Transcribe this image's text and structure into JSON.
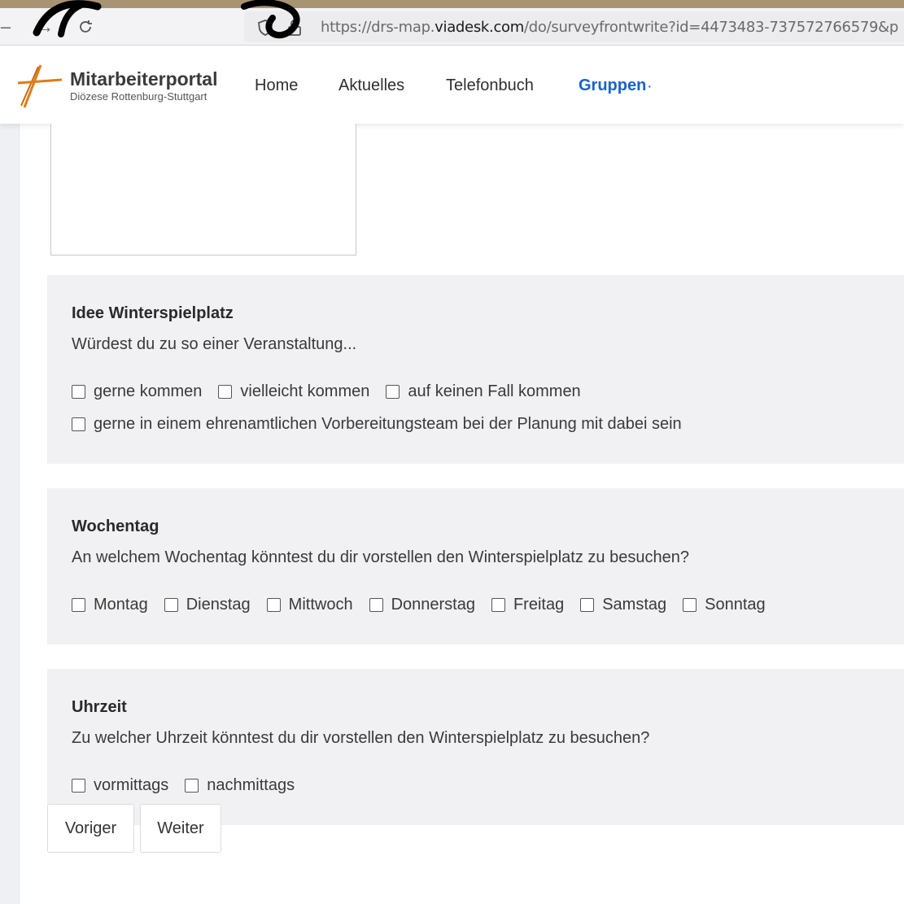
{
  "browser": {
    "url_prefix": "https://drs-map.",
    "url_domain": "viadesk.com",
    "url_path": "/do/surveyfrontwrite?id=4473483-737572766579&p"
  },
  "header": {
    "logo_title": "Mitarbeiterportal",
    "logo_subtitle": "Diözese Rottenburg-Stuttgart",
    "nav": [
      "Home",
      "Aktuelles",
      "Telefonbuch",
      "Gruppen"
    ],
    "nav_active": "Gruppen",
    "nav_active_suffix": "·"
  },
  "sections": [
    {
      "title": "Idee Winterspielplatz",
      "question": "Würdest du zu so einer Veranstaltung...",
      "rows": [
        [
          {
            "label": "gerne kommen",
            "checked": false
          },
          {
            "label": "vielleicht kommen",
            "checked": false
          },
          {
            "label": "auf keinen Fall kommen",
            "checked": false
          }
        ],
        [
          {
            "label": "gerne in einem ehrenamtlichen Vorbereitungsteam bei der Planung mit dabei sein",
            "checked": false
          }
        ]
      ]
    },
    {
      "title": "Wochentag",
      "question": "An welchem Wochentag könntest du dir vorstellen den Winterspielplatz zu besuchen?",
      "rows": [
        [
          {
            "label": "Montag",
            "checked": false
          },
          {
            "label": "Dienstag",
            "checked": false
          },
          {
            "label": "Mittwoch",
            "checked": false
          },
          {
            "label": "Donnerstag",
            "checked": false
          },
          {
            "label": "Freitag",
            "checked": false
          },
          {
            "label": "Samstag",
            "checked": false
          },
          {
            "label": "Sonntag",
            "checked": false
          }
        ]
      ]
    },
    {
      "title": "Uhrzeit",
      "question": "Zu welcher Uhrzeit könntest du dir vorstellen den Winterspielplatz zu besuchen?",
      "rows": [
        [
          {
            "label": "vormittags",
            "checked": false
          },
          {
            "label": "nachmittags",
            "checked": false
          }
        ]
      ]
    }
  ],
  "buttons": {
    "previous": "Voriger",
    "next": "Weiter"
  },
  "colors": {
    "accent": "#1a62c9",
    "logo_orange": "#e07b1a",
    "panel": "#f1f1f3"
  }
}
